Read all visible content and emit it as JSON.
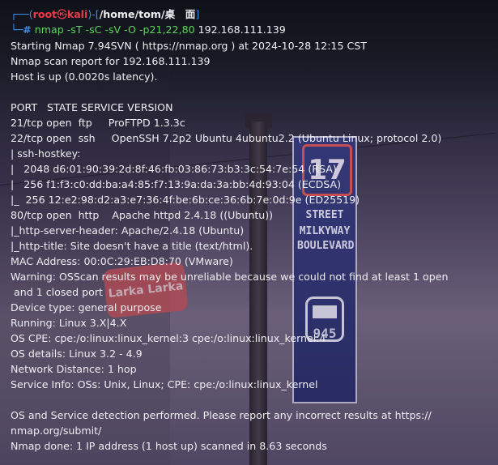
{
  "prompt": {
    "user": "root",
    "skull_glyph": "㉿",
    "host": "kali",
    "path": "/home/tom/桌　面",
    "hash": "#"
  },
  "command": {
    "name": "nmap",
    "flags": "-sT -sC -sV -O -p21,22,80",
    "target": "192.168.111.139"
  },
  "output": [
    "Starting Nmap 7.94SVN ( https://nmap.org ) at 2024-10-28 12:15 CST",
    "Nmap scan report for 192.168.111.139",
    "Host is up (0.0020s latency).",
    "",
    "PORT   STATE SERVICE VERSION",
    "21/tcp open  ftp     ProFTPD 1.3.3c",
    "22/tcp open  ssh     OpenSSH 7.2p2 Ubuntu 4ubuntu2.2 (Ubuntu Linux; protocol 2.0)",
    "| ssh-hostkey: ",
    "|   2048 d6:01:90:39:2d:8f:46:fb:03:86:73:b3:3c:54:7e:54 (RSA)",
    "|   256 f1:f3:c0:dd:ba:a4:85:f7:13:9a:da:3a:bb:4d:93:04 (ECDSA)",
    "|_  256 12:e2:98:d2:a3:e7:36:4f:be:6b:ce:36:6b:7e:0d:9e (ED25519)",
    "80/tcp open  http    Apache httpd 2.4.18 ((Ubuntu))",
    "|_http-server-header: Apache/2.4.18 (Ubuntu)",
    "|_http-title: Site doesn't have a title (text/html).",
    "MAC Address: 00:0C:29:EB:D8:70 (VMware)",
    "Warning: OSScan results may be unreliable because we could not find at least 1 open",
    " and 1 closed port",
    "Device type: general purpose",
    "Running: Linux 3.X|4.X",
    "OS CPE: cpe:/o:linux:linux_kernel:3 cpe:/o:linux:linux_kernel:4",
    "OS details: Linux 3.2 - 4.9",
    "Network Distance: 1 hop",
    "Service Info: OSs: Unix, Linux; CPE: cpe:/o:linux:linux_kernel",
    "",
    "OS and Service detection performed. Please report any incorrect results at https://",
    "nmap.org/submit/",
    "Nmap done: 1 IP address (1 host up) scanned in 8.63 seconds"
  ],
  "wallpaper": {
    "sign_number": "17",
    "sign_lines": [
      "STREET",
      "MILKYWAY",
      "BOULEVARD"
    ],
    "sign_bottom": "945",
    "cafe_text": "Larka Larka"
  },
  "colors": {
    "prompt_blue": "#3b8eea",
    "prompt_red": "#ea3b4b",
    "command_green": "#5fd35f",
    "text": "#eeeef2"
  }
}
